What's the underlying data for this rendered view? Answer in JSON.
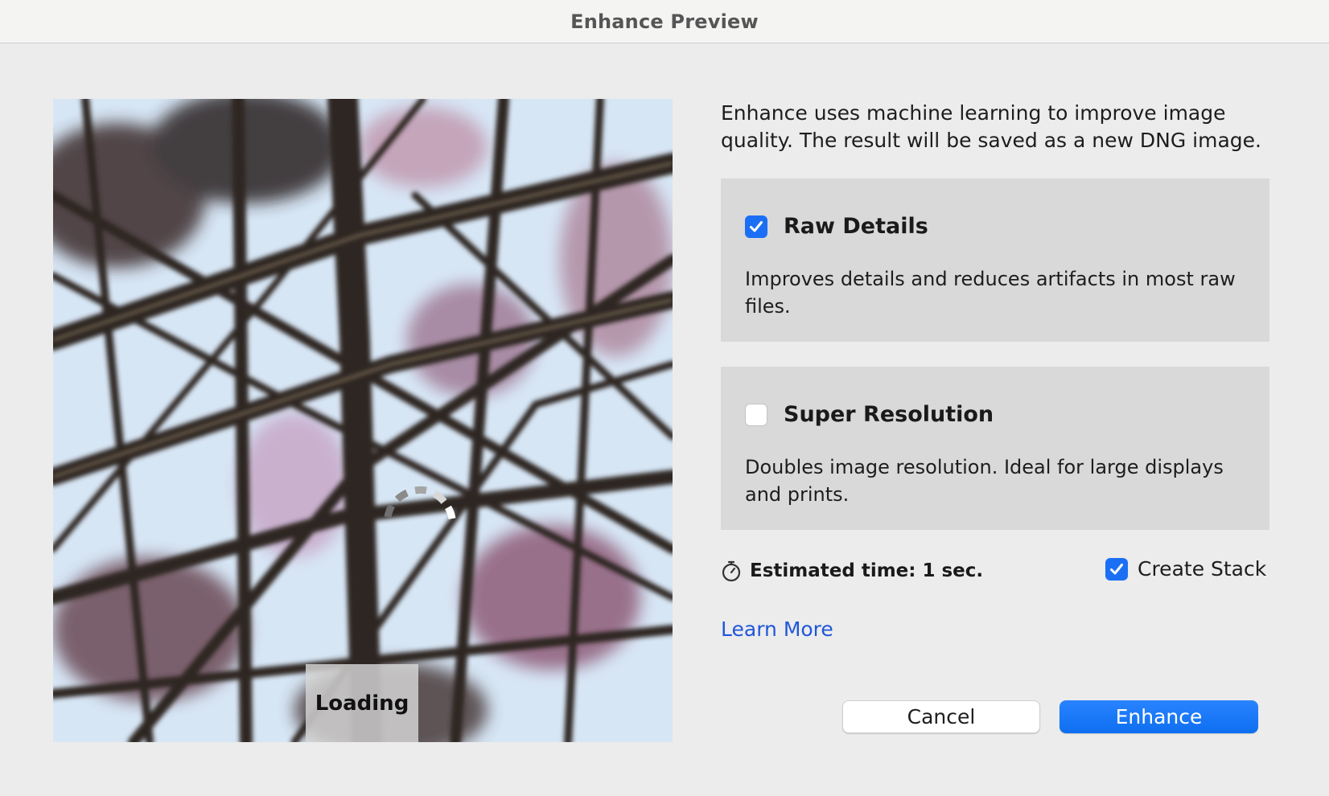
{
  "window": {
    "title": "Enhance Preview"
  },
  "preview": {
    "loading_label": "Loading"
  },
  "description": "Enhance uses machine learning to improve image quality. The result will be saved as a new DNG image.",
  "options": {
    "raw_details": {
      "label": "Raw Details",
      "checked": true,
      "description": "Improves details and reduces artifacts in most raw files."
    },
    "super_resolution": {
      "label": "Super Resolution",
      "checked": false,
      "description": "Doubles image resolution. Ideal for large displays and prints."
    }
  },
  "estimate": {
    "text": "Estimated time: 1 sec.",
    "icon": "stopwatch-icon"
  },
  "create_stack": {
    "label": "Create Stack",
    "checked": true
  },
  "learn_more": "Learn More",
  "buttons": {
    "cancel": "Cancel",
    "enhance": "Enhance"
  },
  "colors": {
    "accent": "#1b6ff5",
    "link": "#1f57d9",
    "panel": "#d9d9d9",
    "background": "#ececec"
  }
}
